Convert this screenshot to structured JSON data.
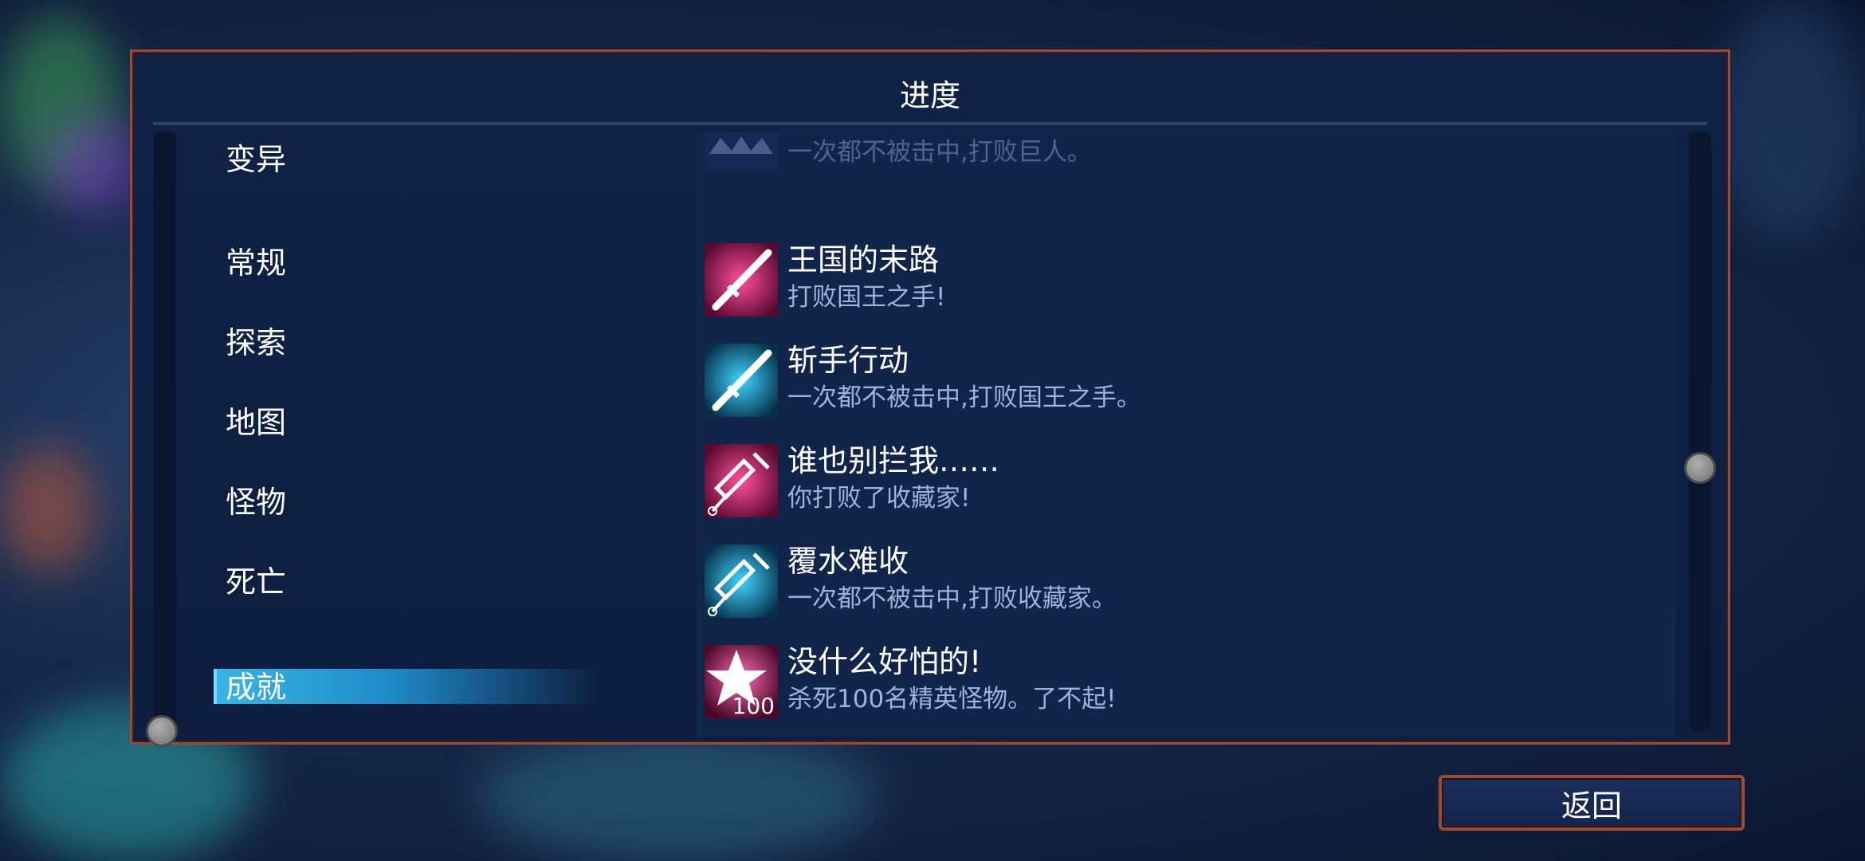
{
  "panel": {
    "title": "进度"
  },
  "categories": [
    {
      "label": "变异",
      "selected": false
    },
    {
      "label": "常规",
      "selected": false
    },
    {
      "label": "探索",
      "selected": false
    },
    {
      "label": "地图",
      "selected": false
    },
    {
      "label": "怪物",
      "selected": false
    },
    {
      "label": "死亡",
      "selected": false
    },
    {
      "label": "成就",
      "selected": true
    }
  ],
  "achievements": [
    {
      "title": "",
      "desc": "一次都不被击中,打败巨人。",
      "icon": "giant-icon",
      "partial": true
    },
    {
      "title": "王国的末路",
      "desc": "打败国王之手!",
      "icon": "sword-pink-icon",
      "color": "#ff3a8c"
    },
    {
      "title": "斩手行动",
      "desc": "一次都不被击中,打败国王之手。",
      "icon": "sword-cyan-icon",
      "color": "#2fd0ff"
    },
    {
      "title": "谁也别拦我……",
      "desc": "你打败了收藏家!",
      "icon": "syringe-pink-icon",
      "color": "#ff3a8c"
    },
    {
      "title": "覆水难收",
      "desc": "一次都不被击中,打败收藏家。",
      "icon": "syringe-cyan-icon",
      "color": "#2fd0ff"
    },
    {
      "title": "没什么好怕的!",
      "desc": "杀死100名精英怪物。了不起!",
      "icon": "star-icon",
      "icon_text": "100",
      "color": "#ff3a8c"
    }
  ],
  "back_button": {
    "label": "返回"
  },
  "colors": {
    "panel_border": "#9a4a3a",
    "selected": "#2a9fd8",
    "desc_text": "#9fb1de"
  }
}
